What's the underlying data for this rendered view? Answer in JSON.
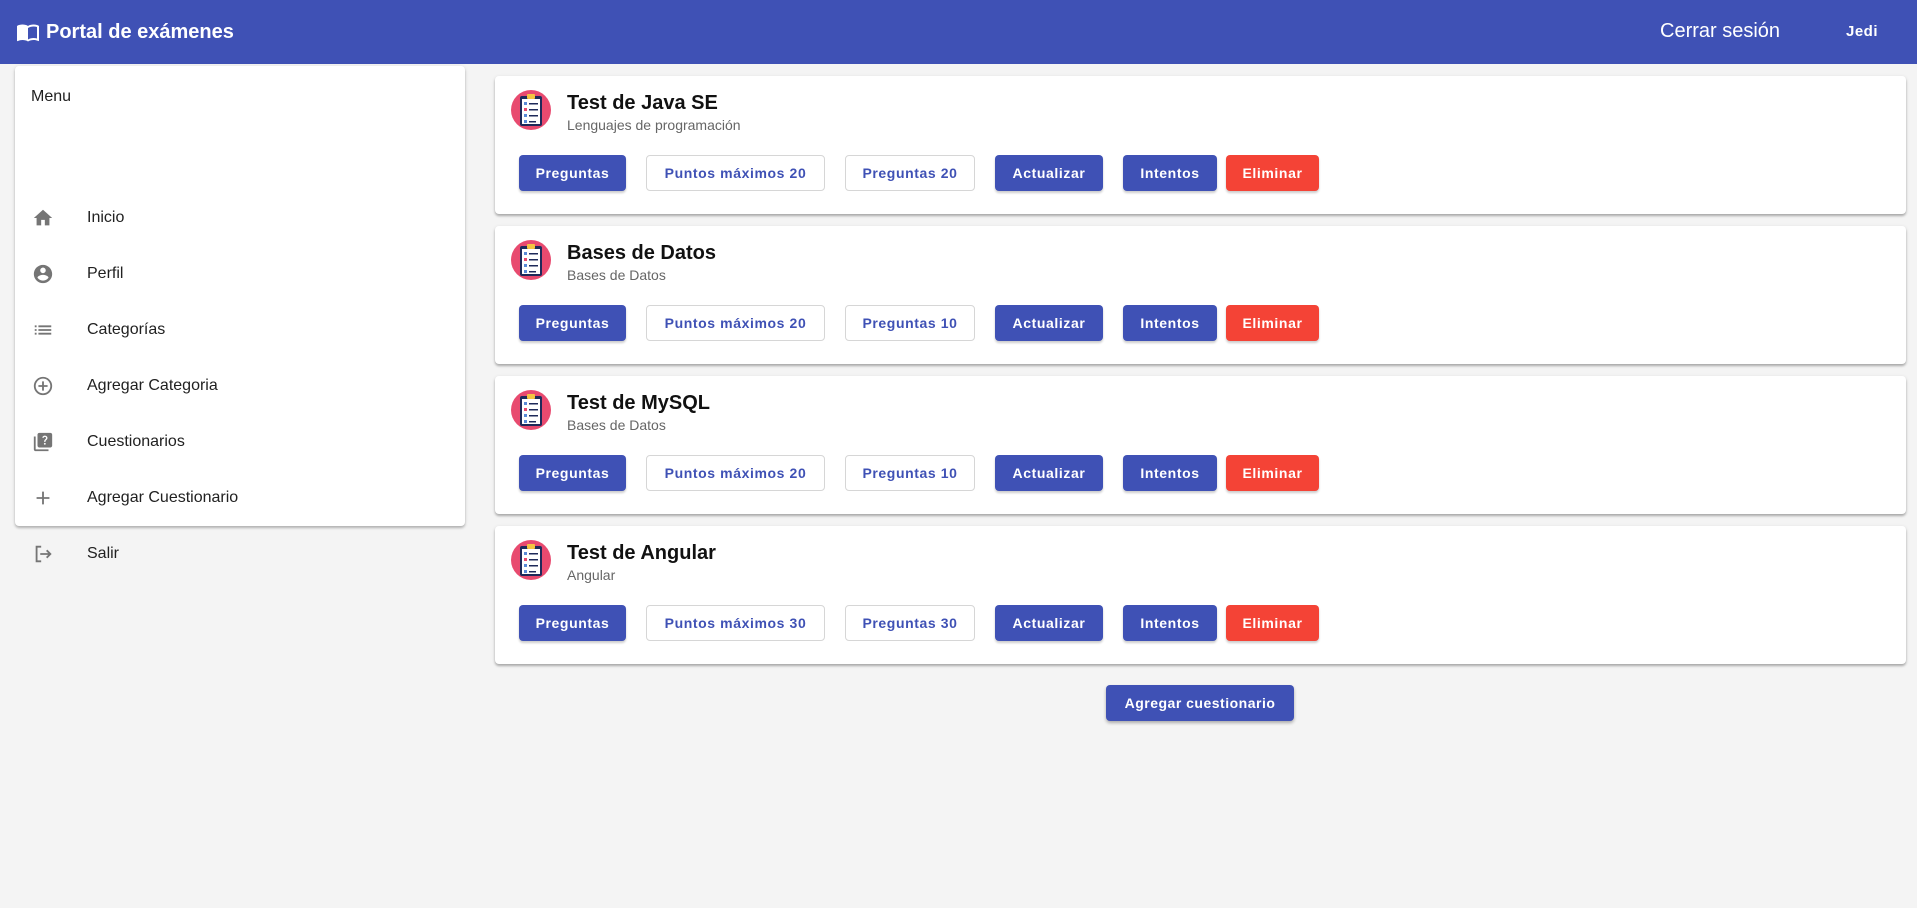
{
  "header": {
    "title": "Portal de exámenes",
    "logout_label": "Cerrar sesión",
    "user_label": "Jedi"
  },
  "sidebar": {
    "title": "Menu",
    "items": [
      {
        "label": "Inicio",
        "icon": "home-icon"
      },
      {
        "label": "Perfil",
        "icon": "account-circle-icon"
      },
      {
        "label": "Categorías",
        "icon": "list-icon"
      },
      {
        "label": "Agregar Categoria",
        "icon": "add-circle-outline-icon"
      },
      {
        "label": "Cuestionarios",
        "icon": "quiz-icon"
      },
      {
        "label": "Agregar Cuestionario",
        "icon": "add-icon"
      },
      {
        "label": "Salir",
        "icon": "logout-icon"
      }
    ]
  },
  "quizzes": [
    {
      "title": "Test de Java SE",
      "subtitle": "Lenguajes de programación",
      "questions_label": "Preguntas",
      "max_points_label": "Puntos máximos 20",
      "num_questions_label": "Preguntas 20",
      "update_label": "Actualizar",
      "attempts_label": "Intentos",
      "delete_label": "Eliminar"
    },
    {
      "title": "Bases de Datos",
      "subtitle": "Bases de Datos",
      "questions_label": "Preguntas",
      "max_points_label": "Puntos máximos 20",
      "num_questions_label": "Preguntas 10",
      "update_label": "Actualizar",
      "attempts_label": "Intentos",
      "delete_label": "Eliminar"
    },
    {
      "title": "Test de MySQL",
      "subtitle": "Bases de Datos",
      "questions_label": "Preguntas",
      "max_points_label": "Puntos máximos 20",
      "num_questions_label": "Preguntas 10",
      "update_label": "Actualizar",
      "attempts_label": "Intentos",
      "delete_label": "Eliminar"
    },
    {
      "title": "Test de Angular",
      "subtitle": "Angular",
      "questions_label": "Preguntas",
      "max_points_label": "Puntos máximos 30",
      "num_questions_label": "Preguntas 30",
      "update_label": "Actualizar",
      "attempts_label": "Intentos",
      "delete_label": "Eliminar"
    }
  ],
  "add_quiz_label": "Agregar cuestionario",
  "colors": {
    "primary": "#3f51b5",
    "warn": "#f44336",
    "background": "#f4f4f4"
  }
}
